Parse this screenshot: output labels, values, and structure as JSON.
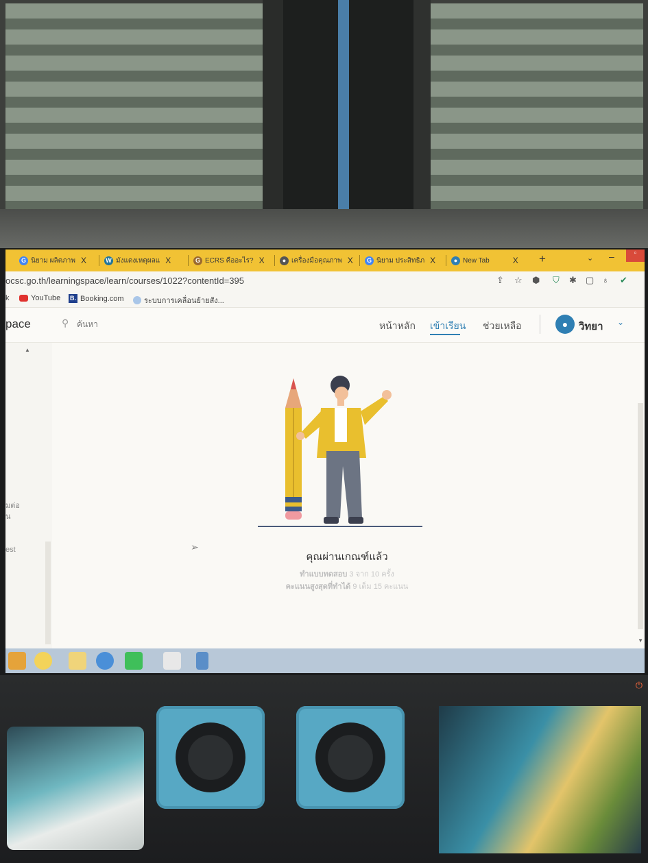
{
  "browser": {
    "tabs": [
      {
        "label": "นิยาม ผลิตภาพ",
        "close": "X"
      },
      {
        "label": "มังแดงเหตุผลแ",
        "close": "X"
      },
      {
        "label": "ECRS คืออะไร?",
        "close": "X"
      },
      {
        "label": "เครื่องมือคุณภาพ",
        "close": "X"
      },
      {
        "label": "นิยาม ประสิทธิภ",
        "close": "X"
      },
      {
        "label": "New Tab",
        "close": "X"
      }
    ],
    "new_tab": "+",
    "url": "ocsc.go.th/learningspace/learn/courses/1022?contentId=395",
    "bookmarks": [
      {
        "label": "k"
      },
      {
        "label": "YouTube"
      },
      {
        "label": "Booking.com"
      },
      {
        "label": "ระบบการเคลื่อนย้ายสัง..."
      }
    ]
  },
  "site": {
    "logo_text": "pace",
    "search_placeholder": "ค้นหา",
    "nav": {
      "home": "หน้าหลัก",
      "learn": "เข้าเรียน",
      "help": "ช่วยเหลือ"
    },
    "user_name": "วิทยา"
  },
  "sidebar": {
    "snippet_1": "มต่อ",
    "snippet_2": "น",
    "snippet_3": "est"
  },
  "result": {
    "title": "คุณผ่านเกณฑ์แล้ว",
    "attempts_label": "ทำแบบทดสอบ",
    "attempts_value": "3 จาก 10 ครั้ง",
    "best_label": "คะแนนสูงสุดที่ทำได้",
    "best_value": "9 เต็ม 15 คะแนน"
  },
  "colors": {
    "tab_strip": "#f1c234",
    "accent": "#2f7fb3",
    "illustration_yellow": "#e9bf2e"
  }
}
